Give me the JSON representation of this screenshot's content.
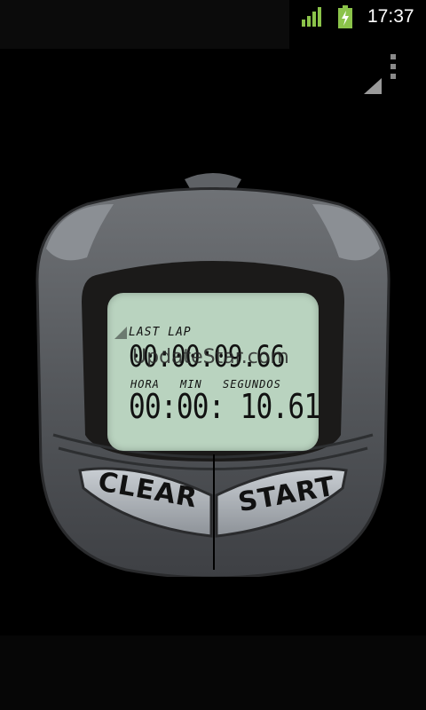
{
  "status_bar": {
    "time": "17:37",
    "signal_icon": "signal-bars-icon",
    "battery_icon": "battery-charging-icon",
    "accent": "#8bc34a"
  },
  "menu": {
    "icon": "overflow-menu-icon"
  },
  "display": {
    "last_lap_label": "LAST LAP",
    "last_lap_time": "00:00:09.66",
    "watermark": "UpdateStar.com",
    "hora_label": "HORA",
    "min_label": "MIN",
    "segundos_label": "SEGUNDOS",
    "current_time": "00:00: 10.61",
    "background": "#b9d3bf"
  },
  "buttons": {
    "clear_label": "CLEAR",
    "start_label": "START"
  }
}
